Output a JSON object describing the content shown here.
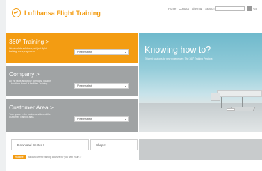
{
  "brand": {
    "name": "Lufthansa Flight Training",
    "accent": "#f39c12",
    "panel_gray": "#a0a3a4"
  },
  "topnav": {
    "links": [
      "Home",
      "Contact",
      "Sitemap",
      "Search"
    ],
    "search_placeholder": "",
    "lang": "Go"
  },
  "panels": [
    {
      "title": "360° Training >",
      "text": "We simulate solutions, not just flight training, crew, engineers.",
      "select": "Please select"
    },
    {
      "title": "Company >",
      "text": "All the facts about our company, location – locations from LH facilities Training.",
      "select": "Please select"
    },
    {
      "title": "Customer Area >",
      "text": "Your space in the business side and the Customer Training area.",
      "select": "Please select"
    }
  ],
  "hero": {
    "headline": "Knowing how to?",
    "subline": "Efficient solutions for new experiences: The 360° Training Principle."
  },
  "bottom": {
    "download": "Download Center >",
    "shop": "Shop >"
  },
  "news": {
    "badge": "Headline",
    "text": "All our current training courses for you with Yours >"
  }
}
